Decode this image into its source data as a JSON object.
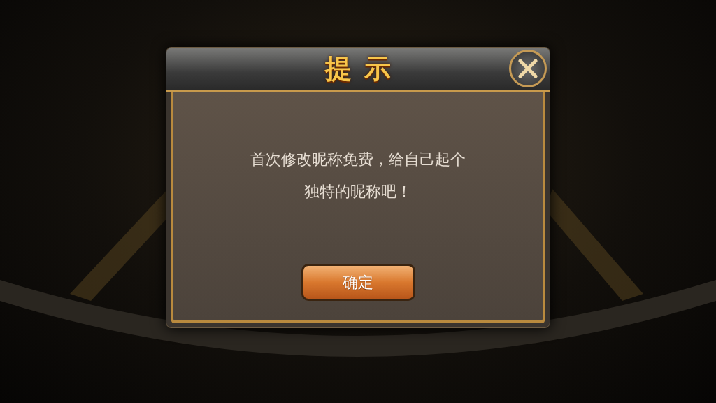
{
  "dialog": {
    "title": "提示",
    "message": "首次修改昵称免费，给自己起个独特的昵称吧！",
    "confirm_button": "确定"
  }
}
